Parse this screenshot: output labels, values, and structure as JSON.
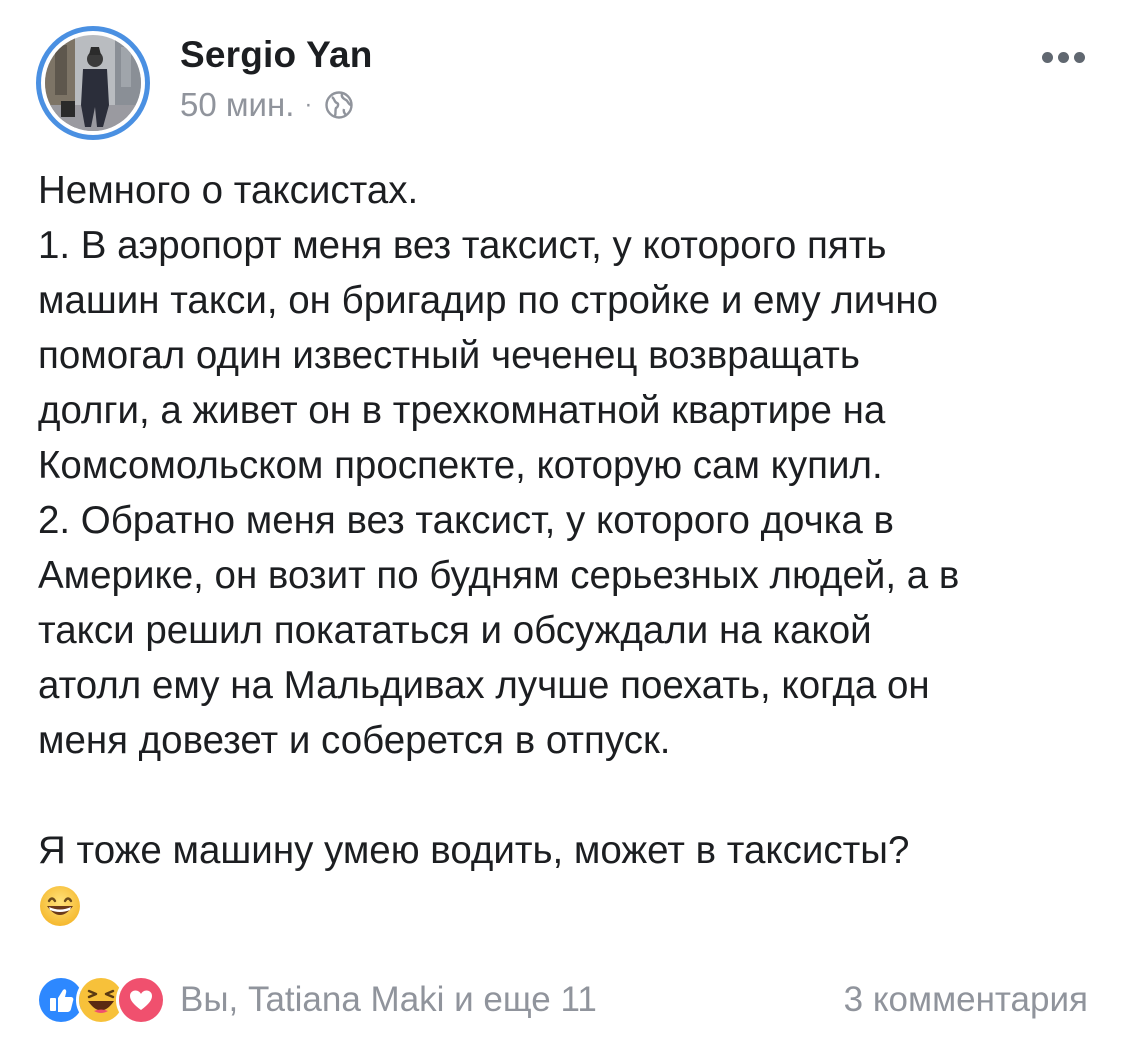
{
  "author": {
    "name": "Sergio Yan",
    "timestamp": "50 мин.",
    "separator": "·",
    "audience_icon": "globe-icon",
    "avatar_ring_color": "#4a90e2"
  },
  "post": {
    "lines": [
      "Немного о таксистах.",
      "1. В аэропорт меня вез таксист, у которого пять",
      "машин такси, он бригадир по стройке и ему лично",
      "помогал один известный чеченец возвращать",
      "долги, а живет он в трехкомнатной квартире на",
      "Комсомольском проспекте, которую сам купил.",
      "2. Обратно меня вез таксист, у которого дочка в",
      "Америке, он возит по будням серьезных людей, а в",
      "такси решил покататься и обсуждали на какой",
      "атолл ему на Мальдивах лучше поехать, когда он",
      "меня довезет и соберется в отпуск."
    ],
    "closing_line": "Я тоже машину умею водить, может в таксисты?",
    "emoji": "grinning-face-emoji"
  },
  "footer": {
    "reaction_icons": [
      "like-icon",
      "haha-icon",
      "love-icon"
    ],
    "reactors_text": "Вы, Tatiana Maki и еще 11",
    "comments_text": "3 комментария",
    "colors": {
      "like": "#2d88ff",
      "haha": "#f7c13a",
      "love": "#f0506e",
      "muted_text": "#90949c"
    }
  }
}
